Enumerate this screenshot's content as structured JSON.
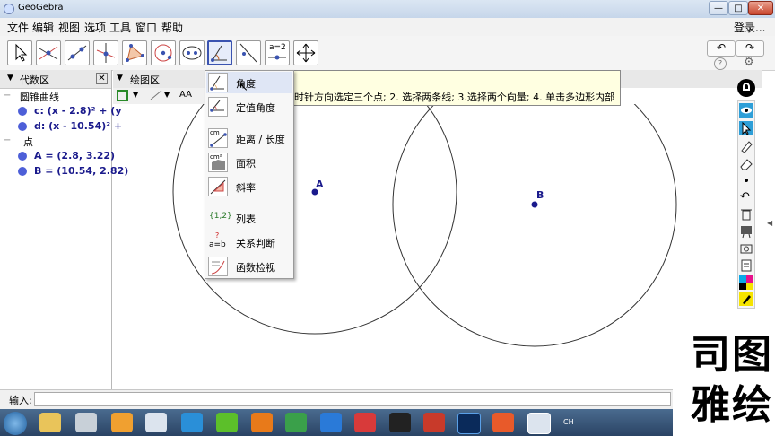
{
  "window": {
    "title": "GeoGebra",
    "minimize": "—",
    "maximize": "□",
    "close": "✕"
  },
  "menubar": {
    "items": [
      "文件",
      "编辑",
      "视图",
      "选项",
      "工具",
      "窗口",
      "帮助"
    ],
    "login": "登录..."
  },
  "toolbar": {
    "tools": [
      "move-tool",
      "point-tool",
      "line-tool",
      "perpendicular-tool",
      "polygon-tool",
      "circle-tool",
      "conic-tool",
      "angle-tool",
      "reflect-tool",
      "slider-tool",
      "move-graphics-tool"
    ],
    "selected_index": 7,
    "slider_label": "a=2",
    "undo": "↶",
    "redo": "↷",
    "help": "?",
    "settings": "⚙"
  },
  "algebra": {
    "header": "代数区",
    "groups": [
      {
        "label": "圆锥曲线",
        "items": [
          "c: (x - 2.8)² + (y",
          "d: (x - 10.54)² +"
        ]
      },
      {
        "label": "点",
        "items": [
          "A = (2.8, 3.22)",
          "B = (10.54, 2.82)"
        ]
      }
    ]
  },
  "graphics": {
    "header": "绘图区",
    "point_a": "A",
    "point_b": "B",
    "style_aa": "AA"
  },
  "tooltip": {
    "text": "时针方向选定三个点; 2. 选择两条线; 3.选择两个向量; 4. 单击多边形内部"
  },
  "dropdown": {
    "items": [
      {
        "label": "角度",
        "icon": "angle-icon"
      },
      {
        "label": "定值角度",
        "icon": "fixed-angle-icon"
      },
      {
        "label": "距离 / 长度",
        "icon": "distance-icon",
        "icon_text": "cm"
      },
      {
        "label": "面积",
        "icon": "area-icon",
        "icon_text": "cm²"
      },
      {
        "label": "斜率",
        "icon": "slope-icon"
      },
      {
        "label": "列表",
        "icon": "list-icon",
        "icon_text": "{1,2}"
      },
      {
        "label": "关系判断",
        "icon": "relation-icon",
        "icon_text": "a=b"
      },
      {
        "label": "函数检视",
        "icon": "function-inspector-icon"
      }
    ]
  },
  "inputbar": {
    "label": "输入:"
  },
  "taskbar": {
    "lang": "CH"
  },
  "watermark": {
    "line1": "司图",
    "line2": "雅绘"
  },
  "colors": {
    "point": "#1a1a8c",
    "accent": "#3a53b0",
    "algebra_dot": "#4d5fd8"
  }
}
